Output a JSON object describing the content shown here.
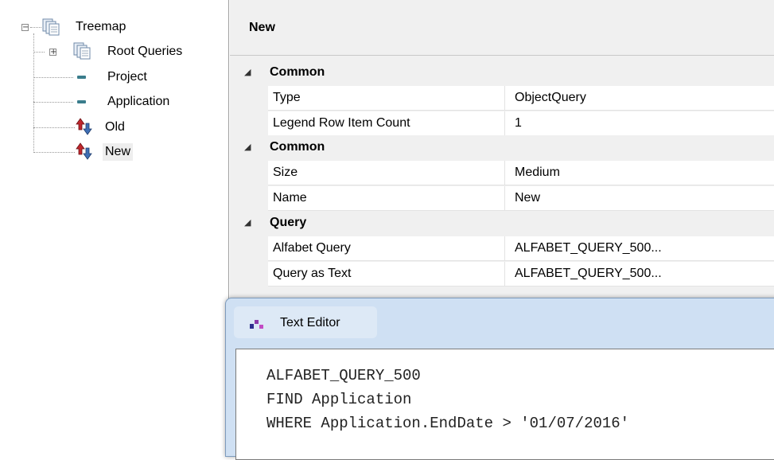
{
  "tree": {
    "nodes": [
      {
        "label": "Treemap"
      },
      {
        "label": "Root Queries"
      },
      {
        "label": "Project"
      },
      {
        "label": "Application"
      },
      {
        "label": "Old"
      },
      {
        "label": "New"
      }
    ],
    "expander_collapse": "−",
    "expander_expand": "+"
  },
  "properties": {
    "title": "New",
    "categories": [
      {
        "label": "Common",
        "rows": [
          {
            "name": "Type",
            "value": "ObjectQuery"
          },
          {
            "name": "Legend Row Item Count",
            "value": "1"
          }
        ]
      },
      {
        "label": "Common",
        "rows": [
          {
            "name": "Size",
            "value": "Medium"
          },
          {
            "name": "Name",
            "value": "New"
          }
        ]
      },
      {
        "label": "Query",
        "rows": [
          {
            "name": "Alfabet Query",
            "value": "ALFABET_QUERY_500..."
          },
          {
            "name": "Query as Text",
            "value": "ALFABET_QUERY_500..."
          }
        ]
      }
    ],
    "collapse_glyph": "◢"
  },
  "editor": {
    "title": "Text Editor",
    "lines": [
      "ALFABET_QUERY_500",
      "FIND Application",
      "WHERE Application.EndDate > '01/07/2016'"
    ]
  },
  "colors": {
    "selection": "#eeeeee",
    "editor_frame": "#cfe0f3",
    "query_icon_teal": "#3a7d8c"
  }
}
